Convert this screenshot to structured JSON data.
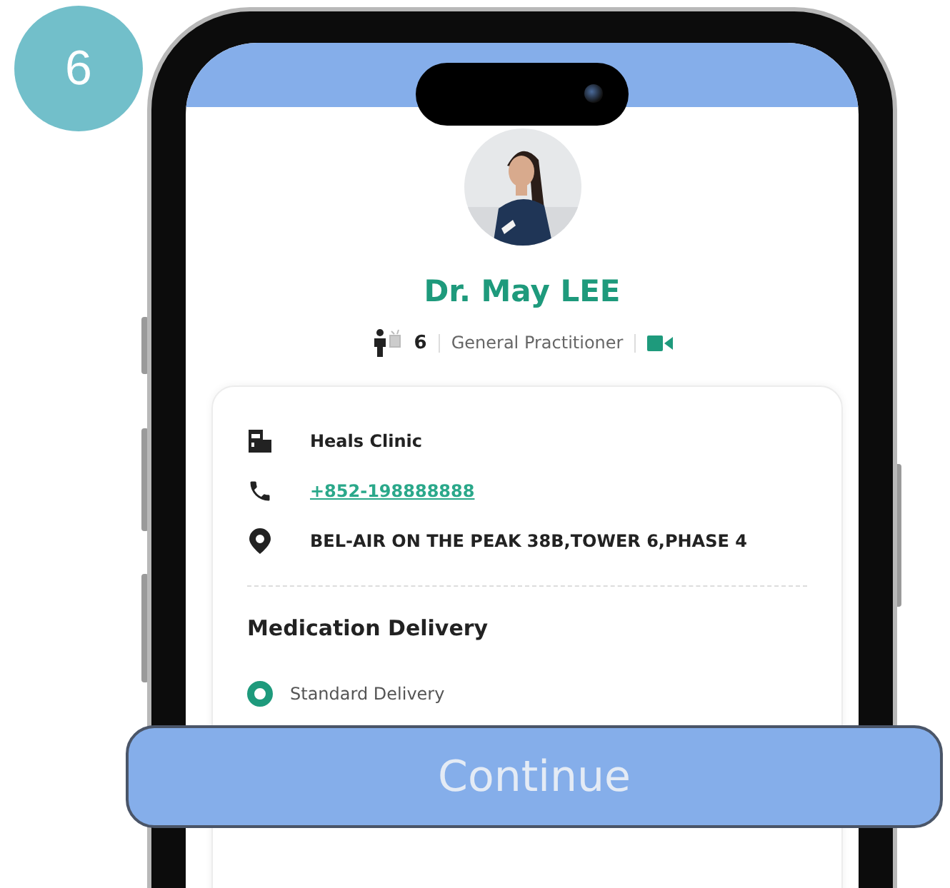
{
  "step_badge": "6",
  "doctor": {
    "name": "Dr. May LEE",
    "count": "6",
    "specialty": "General Practitioner",
    "video": true
  },
  "clinic": {
    "name": "Heals Clinic",
    "phone": "+852-198888888",
    "address": "BEL-AIR ON THE PEAK 38B,TOWER 6,PHASE 4"
  },
  "delivery": {
    "title": "Medication Delivery",
    "options": [
      {
        "label": "Standard Delivery",
        "selected": true
      }
    ]
  },
  "continue_button": "Continue"
}
